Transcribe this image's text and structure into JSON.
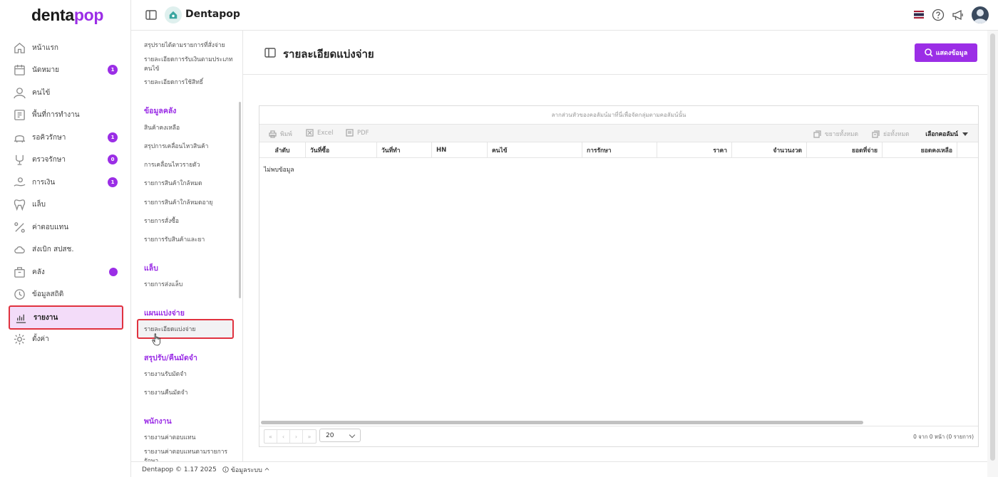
{
  "app": {
    "logo_main": "denta",
    "logo_accent": "pop",
    "title": "Dentapop"
  },
  "sidebar": {
    "items": [
      {
        "label": "หน้าแรก",
        "icon": "home-icon"
      },
      {
        "label": "นัดหมาย",
        "icon": "calendar-icon",
        "badge": "1"
      },
      {
        "label": "คนไข้",
        "icon": "user-icon"
      },
      {
        "label": "พื้นที่การทำงาน",
        "icon": "workspace-icon"
      },
      {
        "label": "รอคิวรักษา",
        "icon": "queue-icon",
        "badge": "1"
      },
      {
        "label": "ตรวจรักษา",
        "icon": "treatment-icon",
        "badge": "0"
      },
      {
        "label": "การเงิน",
        "icon": "money-hand-icon",
        "badge": "1"
      },
      {
        "label": "แล็บ",
        "icon": "tooth-icon"
      },
      {
        "label": "ค่าตอบแทน",
        "icon": "percent-icon"
      },
      {
        "label": "ส่งเบิก สปสช.",
        "icon": "cloud-icon"
      },
      {
        "label": "คลัง",
        "icon": "inventory-icon",
        "dot": true
      },
      {
        "label": "ข้อมูลสถิติ",
        "icon": "stats-icon"
      },
      {
        "label": "รายงาน",
        "icon": "report-icon",
        "active": true
      },
      {
        "label": "ตั้งค่า",
        "icon": "gear-icon"
      }
    ]
  },
  "submenu": {
    "top_links": [
      "สรุปรายได้ตามรายการที่สั่งจ่าย",
      "รายละเอียดการรับเงินตามประเภทคนไข้",
      "รายละเอียดการใช้สิทธิ์"
    ],
    "sections": [
      {
        "title": "ข้อมูลคลัง",
        "links": [
          "สินค้าคงเหลือ",
          "สรุปการเคลื่อนไหวสินค้า",
          "การเคลื่อนไหวรายตัว",
          "รายการสินค้าใกล้หมด",
          "รายการสินค้าใกล้หมดอายุ",
          "รายการสั่งซื้อ",
          "รายการรับสินค้าและยา"
        ]
      },
      {
        "title": "แล็บ",
        "links": [
          "รายการส่งแล็บ"
        ]
      },
      {
        "title": "แผนแบ่งจ่าย",
        "links": [
          "รายละเอียดแบ่งจ่าย"
        ]
      },
      {
        "title": "สรุปรับ/คืนมัดจำ",
        "links": [
          "รายงานรับมัดจำ",
          "รายงานคืนมัดจำ"
        ]
      },
      {
        "title": "พนักงาน",
        "links": [
          "รายงานค่าตอบแทน",
          "รายงานค่าตอบแทนตามรายการรักษา"
        ]
      }
    ]
  },
  "page": {
    "title": "รายละเอียดแบ่งจ่าย",
    "show_button": "แสดงข้อมูล"
  },
  "grid": {
    "group_hint": "ลากส่วนหัวของคอลัมน์มาที่นี่เพื่อจัดกลุ่มตามคอลัมน์นั้น",
    "toolbar": {
      "print": "พิมพ์",
      "excel": "Excel",
      "pdf": "PDF",
      "expand_all": "ขยายทั้งหมด",
      "collapse_all": "ย่อทั้งหมด",
      "choose_columns": "เลือกคอลัมน์"
    },
    "columns": [
      "ลำดับ",
      "วันที่ซื้อ",
      "วันที่ทำ",
      "HN",
      "คนไข้",
      "การรักษา",
      "ราคา",
      "จำนวนงวด",
      "ยอดที่จ่าย",
      "ยอดคงเหลือ"
    ],
    "empty_text": "ไม่พบข้อมูล",
    "page_size": "20",
    "pager": [
      "«",
      "‹",
      "›",
      "»"
    ],
    "page_info": "0 จาก 0 หน้า (0 รายการ)"
  },
  "footer": {
    "version": "Dentapop © 1.17 2025",
    "system_info": "ข้อมูลระบบ"
  },
  "colors": {
    "accent": "#9b2ee6",
    "highlight_border": "#e0323f"
  }
}
